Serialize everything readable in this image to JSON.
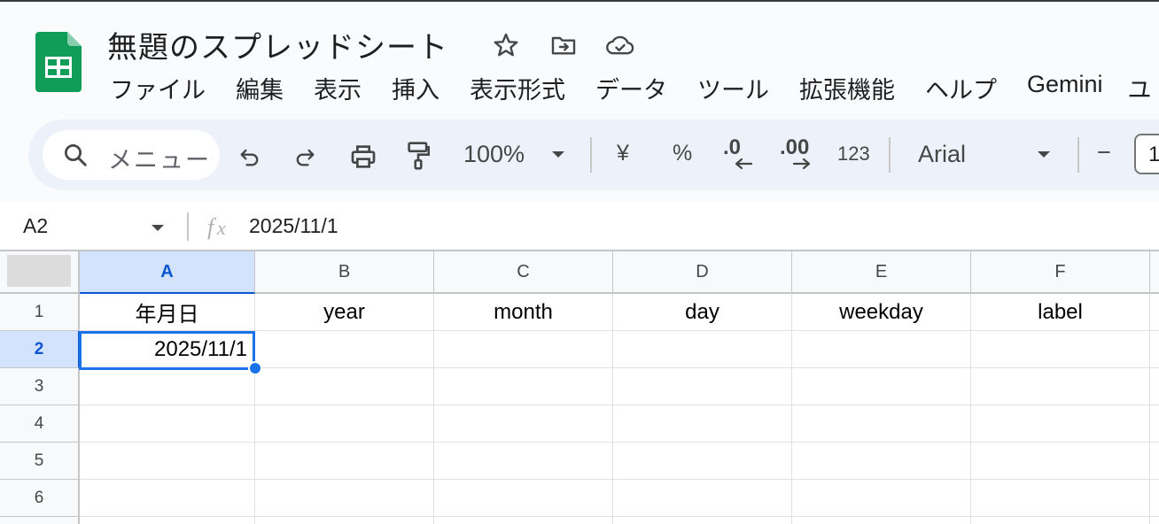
{
  "app": {
    "title": "無題のスプレッドシート",
    "brand_color": "#0f9d58"
  },
  "title_icons": [
    "star-icon",
    "move-to-folder-icon",
    "cloud-saved-icon"
  ],
  "menu": [
    "ファイル",
    "編集",
    "表示",
    "挿入",
    "表示形式",
    "データ",
    "ツール",
    "拡張機能",
    "ヘルプ",
    "Gemini",
    "ユ"
  ],
  "toolbar": {
    "search_label": "メニュー",
    "zoom": "100%",
    "currency": "¥",
    "percent": "%",
    "decrease_decimal": ".0",
    "increase_decimal": ".00",
    "number_format": "123",
    "font": "Arial",
    "minus": "−",
    "font_size_partial": "1"
  },
  "formula_bar": {
    "cell_ref": "A2",
    "value": "2025/11/1"
  },
  "sheet": {
    "columns": [
      "A",
      "B",
      "C",
      "D",
      "E",
      "F"
    ],
    "rows": [
      "1",
      "2",
      "3",
      "4",
      "5",
      "6"
    ],
    "header_row": [
      "年月日",
      "year",
      "month",
      "day",
      "weekday",
      "label"
    ],
    "a2": "2025/11/1",
    "selected_color": "#1a73e8"
  }
}
